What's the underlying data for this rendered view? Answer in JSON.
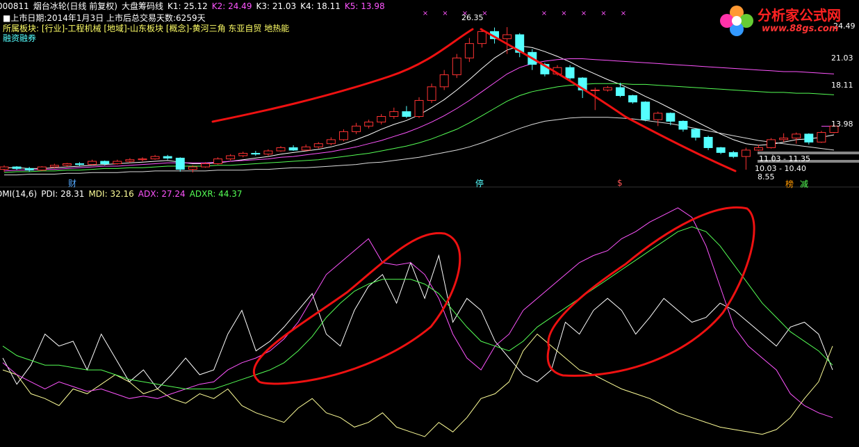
{
  "header": {
    "code": "000811",
    "name": "烟台冰轮(日线 前复权)",
    "indicator": "大盘筹码线",
    "k_values": [
      {
        "label": "K1:",
        "value": "25.12",
        "color": "#ffffff"
      },
      {
        "label": "K2:",
        "value": "24.49",
        "color": "#ff55ff"
      },
      {
        "label": "K3:",
        "value": "21.03",
        "color": "#ffffff"
      },
      {
        "label": "K4:",
        "value": "18.11",
        "color": "#ffffff"
      },
      {
        "label": "K5:",
        "value": "13.98",
        "color": "#ff55ff"
      }
    ]
  },
  "info": {
    "listing": "■上市日期:2014年1月3日 上市后总交易天数:6259天",
    "sectors": "所属板块: [行业]-工程机械 [地域]-山东板块 [概念]-黄河三角 东亚自贸 地热能",
    "margin": "融资融券"
  },
  "markers": {
    "cai": "财",
    "ting": "停",
    "dollar": "$",
    "bang": "榜",
    "jian": "减"
  },
  "price_labels": {
    "high": "26.35",
    "r1": "24.49",
    "r2": "21.03",
    "r3": "18.11",
    "r4": "13.98",
    "range1": "11.03 - 11.35",
    "range2": "10.03 - 10.40",
    "low": "8.55"
  },
  "dmi": {
    "title": "DMI(14,6)",
    "pdi": "PDI: 28.31",
    "mdi": "MDI: 32.16",
    "adx": "ADX: 27.24",
    "adxr": "ADXR: 44.37"
  },
  "logo": {
    "title": "分析家公式网",
    "url": "www.88gs.com"
  },
  "colors": {
    "up": "#ff3333",
    "down": "#55ffff",
    "pdi": "#ffffff",
    "mdi": "#ffff99",
    "adx": "#ff55ff",
    "adxr": "#55ff55",
    "annotation": "#ee1111"
  },
  "chart_data": [
    {
      "type": "candlestick",
      "title": "大盘筹码线",
      "ylim": [
        7,
        28
      ],
      "candles": [
        [
          8.6,
          8.9,
          8.3,
          9.1
        ],
        [
          8.9,
          8.7,
          8.5,
          9.0
        ],
        [
          8.7,
          8.5,
          8.3,
          8.9
        ],
        [
          8.5,
          8.9,
          8.4,
          9.0
        ],
        [
          8.9,
          9.1,
          8.7,
          9.3
        ],
        [
          9.1,
          9.3,
          8.9,
          9.4
        ],
        [
          9.3,
          9.2,
          9.0,
          9.5
        ],
        [
          9.2,
          9.6,
          9.1,
          9.8
        ],
        [
          9.6,
          9.3,
          9.1,
          9.7
        ],
        [
          9.3,
          9.6,
          9.2,
          9.8
        ],
        [
          9.6,
          9.8,
          9.4,
          10.0
        ],
        [
          9.8,
          9.9,
          9.6,
          10.1
        ],
        [
          9.9,
          10.2,
          9.8,
          10.4
        ],
        [
          10.2,
          10.0,
          9.8,
          10.4
        ],
        [
          10.0,
          8.6,
          8.3,
          10.1
        ],
        [
          8.6,
          8.9,
          8.2,
          9.1
        ],
        [
          8.9,
          9.3,
          8.8,
          9.5
        ],
        [
          9.3,
          9.9,
          9.2,
          10.1
        ],
        [
          9.9,
          10.3,
          9.7,
          10.5
        ],
        [
          10.3,
          10.6,
          10.1,
          10.8
        ],
        [
          10.6,
          10.5,
          10.3,
          10.9
        ],
        [
          10.5,
          10.9,
          10.3,
          11.1
        ],
        [
          10.9,
          11.3,
          10.8,
          11.5
        ],
        [
          11.3,
          11.0,
          10.9,
          11.6
        ],
        [
          11.0,
          11.4,
          10.9,
          11.7
        ],
        [
          11.4,
          11.8,
          11.2,
          12.0
        ],
        [
          11.8,
          12.3,
          11.6,
          12.6
        ],
        [
          12.3,
          13.3,
          12.1,
          13.6
        ],
        [
          13.3,
          14.0,
          13.0,
          14.4
        ],
        [
          14.0,
          14.5,
          13.7,
          14.8
        ],
        [
          14.5,
          15.2,
          14.2,
          15.5
        ],
        [
          15.2,
          15.8,
          14.9,
          16.3
        ],
        [
          15.8,
          15.2,
          15.0,
          16.5
        ],
        [
          15.2,
          17.2,
          15.0,
          17.6
        ],
        [
          17.2,
          18.9,
          16.9,
          19.3
        ],
        [
          18.9,
          20.4,
          18.5,
          21.0
        ],
        [
          20.4,
          22.5,
          20.0,
          23.0
        ],
        [
          22.5,
          24.3,
          22.0,
          25.0
        ],
        [
          24.3,
          25.8,
          23.8,
          26.2
        ],
        [
          25.8,
          24.9,
          24.3,
          26.3
        ],
        [
          24.9,
          25.4,
          23.0,
          26.35
        ],
        [
          25.4,
          23.2,
          22.6,
          25.6
        ],
        [
          23.2,
          21.7,
          21.0,
          23.6
        ],
        [
          21.7,
          20.5,
          20.2,
          21.9
        ],
        [
          20.5,
          21.3,
          20.3,
          21.6
        ],
        [
          21.3,
          20.0,
          19.7,
          21.6
        ],
        [
          20.0,
          18.5,
          17.5,
          20.1
        ],
        [
          18.5,
          18.5,
          16.0,
          18.8
        ],
        [
          18.5,
          18.8,
          18.3,
          19.0
        ],
        [
          18.8,
          17.8,
          17.6,
          19.4
        ],
        [
          17.8,
          17.0,
          16.8,
          17.9
        ],
        [
          17.0,
          14.8,
          14.6,
          17.1
        ],
        [
          14.8,
          15.6,
          14.0,
          15.8
        ],
        [
          15.6,
          14.6,
          14.1,
          15.7
        ],
        [
          14.6,
          13.6,
          13.3,
          14.7
        ],
        [
          13.6,
          12.6,
          12.2,
          13.7
        ],
        [
          12.6,
          11.3,
          11.0,
          12.8
        ],
        [
          11.3,
          10.7,
          10.5,
          11.4
        ],
        [
          10.7,
          10.2,
          10.0,
          10.9
        ],
        [
          10.2,
          11.0,
          8.55,
          11.3
        ],
        [
          11.0,
          11.3,
          10.9,
          11.7
        ],
        [
          11.3,
          12.3,
          11.2,
          12.5
        ],
        [
          12.3,
          12.5,
          12.0,
          13.1
        ],
        [
          12.5,
          13.0,
          11.8,
          13.2
        ],
        [
          13.0,
          12.0,
          11.7,
          13.1
        ],
        [
          12.0,
          13.2,
          11.9,
          13.4
        ],
        [
          13.2,
          14.0,
          13.1,
          14.2
        ]
      ],
      "ma_series": [
        {
          "name": "K1",
          "values": [
            8.8,
            8.8,
            8.7,
            8.7,
            8.8,
            8.9,
            9.0,
            9.1,
            9.2,
            9.3,
            9.4,
            9.5,
            9.6,
            9.7,
            9.5,
            9.3,
            9.3,
            9.4,
            9.6,
            9.8,
            10.0,
            10.2,
            10.5,
            10.7,
            10.9,
            11.1,
            11.4,
            11.8,
            12.3,
            12.9,
            13.6,
            14.2,
            14.7,
            15.4,
            16.3,
            17.3,
            18.5,
            19.8,
            21.2,
            22.5,
            23.5,
            24.0,
            23.8,
            23.3,
            22.7,
            22.0,
            21.2,
            20.5,
            19.8,
            19.2,
            18.5,
            17.7,
            17.0,
            16.2,
            15.4,
            14.6,
            13.8,
            13.0,
            12.3,
            11.8,
            11.6,
            11.7,
            12.0,
            12.3,
            12.4,
            12.6,
            12.9
          ]
        },
        {
          "name": "K2",
          "values": [
            8.4,
            8.5,
            8.5,
            8.6,
            8.6,
            8.7,
            8.8,
            8.9,
            9.0,
            9.0,
            9.1,
            9.2,
            9.3,
            9.4,
            9.4,
            9.4,
            9.4,
            9.5,
            9.6,
            9.7,
            9.8,
            9.9,
            10.1,
            10.2,
            10.4,
            10.6,
            10.8,
            11.1,
            11.4,
            11.8,
            12.2,
            12.7,
            13.2,
            13.8,
            14.5,
            15.3,
            16.2,
            17.2,
            18.3,
            19.4,
            20.5,
            21.3,
            21.8,
            22.1,
            22.3,
            22.4,
            22.4,
            22.3,
            22.2,
            22.1,
            22.0,
            21.9,
            21.8,
            21.7,
            21.6,
            21.5,
            21.4,
            21.3,
            21.2,
            21.1,
            21.0,
            20.9,
            20.8,
            20.8,
            20.7,
            20.6,
            20.5
          ]
        },
        {
          "name": "K3",
          "values": [
            8.2,
            8.3,
            8.3,
            8.4,
            8.4,
            8.5,
            8.5,
            8.6,
            8.7,
            8.7,
            8.8,
            8.8,
            8.9,
            9.0,
            9.0,
            9.0,
            9.0,
            9.1,
            9.1,
            9.2,
            9.3,
            9.4,
            9.5,
            9.6,
            9.7,
            9.8,
            10.0,
            10.2,
            10.4,
            10.6,
            10.9,
            11.2,
            11.5,
            11.9,
            12.4,
            13.0,
            13.6,
            14.4,
            15.3,
            16.2,
            17.1,
            17.8,
            18.3,
            18.6,
            18.9,
            19.1,
            19.2,
            19.3,
            19.3,
            19.3,
            19.2,
            19.2,
            19.1,
            19.0,
            18.9,
            18.8,
            18.7,
            18.6,
            18.5,
            18.4,
            18.3,
            18.2,
            18.2,
            18.1,
            18.1,
            18.0,
            17.9
          ]
        },
        {
          "name": "K4",
          "values": [
            7.9,
            7.9,
            8.0,
            8.0,
            8.0,
            8.1,
            8.1,
            8.2,
            8.2,
            8.2,
            8.3,
            8.3,
            8.4,
            8.4,
            8.4,
            8.4,
            8.4,
            8.5,
            8.5,
            8.5,
            8.6,
            8.6,
            8.7,
            8.8,
            8.8,
            8.9,
            9.0,
            9.1,
            9.2,
            9.4,
            9.5,
            9.7,
            9.9,
            10.1,
            10.4,
            10.7,
            11.0,
            11.4,
            11.9,
            12.5,
            13.1,
            13.7,
            14.2,
            14.6,
            14.8,
            15.0,
            15.1,
            15.1,
            15.1,
            15.0,
            14.9,
            14.7,
            14.5,
            14.3,
            14.0,
            13.7,
            13.4,
            13.1,
            12.8,
            12.5,
            12.2,
            12.0,
            11.8,
            11.6,
            11.4,
            11.2,
            11.0
          ]
        },
        {
          "name": "K5",
          "values": [
            null,
            null,
            null,
            null,
            null,
            null,
            null,
            null,
            null,
            null,
            null,
            null,
            null,
            null,
            null,
            null,
            null,
            null,
            null,
            null,
            null,
            null,
            null,
            null,
            null,
            null,
            null,
            null,
            null,
            null,
            null,
            null,
            null,
            null,
            null,
            null,
            null,
            null,
            null,
            null,
            null,
            null,
            null,
            null,
            null,
            null,
            null,
            null,
            null,
            null,
            null,
            null,
            null,
            null,
            null,
            null,
            null,
            null,
            null,
            null,
            null,
            null,
            null,
            null,
            null,
            13.98,
            13.98
          ]
        }
      ]
    },
    {
      "type": "line",
      "title": "DMI(14,6)",
      "ylim": [
        0,
        100
      ],
      "x": [
        0,
        1,
        2,
        3,
        4,
        5,
        6,
        7,
        8,
        9,
        10,
        11,
        12,
        13,
        14,
        15,
        16,
        17,
        18,
        19,
        20,
        21,
        22,
        23,
        24,
        25,
        26,
        27,
        28,
        29,
        30,
        31,
        32,
        33,
        34,
        35,
        36,
        37,
        38,
        39,
        40,
        41,
        42,
        43,
        44,
        45,
        46,
        47,
        48,
        49,
        50,
        51,
        52,
        53,
        54,
        55,
        56,
        57,
        58,
        59
      ],
      "series": [
        {
          "name": "PDI",
          "values": [
            35,
            24,
            32,
            45,
            40,
            42,
            30,
            45,
            35,
            25,
            30,
            22,
            28,
            35,
            28,
            30,
            45,
            55,
            38,
            42,
            48,
            55,
            62,
            45,
            40,
            55,
            65,
            70,
            58,
            75,
            60,
            78,
            50,
            60,
            55,
            42,
            35,
            28,
            25,
            30,
            50,
            45,
            55,
            60,
            55,
            45,
            52,
            60,
            55,
            50,
            52,
            58,
            55,
            50,
            45,
            40,
            48,
            50,
            45,
            30
          ]
        },
        {
          "name": "MDI",
          "values": [
            30,
            28,
            20,
            18,
            15,
            22,
            20,
            24,
            28,
            25,
            20,
            22,
            18,
            16,
            20,
            18,
            22,
            15,
            12,
            10,
            8,
            14,
            18,
            12,
            10,
            6,
            8,
            12,
            6,
            4,
            2,
            8,
            4,
            10,
            18,
            20,
            25,
            38,
            45,
            40,
            35,
            30,
            28,
            25,
            22,
            20,
            18,
            15,
            12,
            10,
            8,
            6,
            5,
            4,
            3,
            5,
            10,
            18,
            25,
            40
          ]
        },
        {
          "name": "ADX",
          "values": [
            33,
            28,
            25,
            22,
            25,
            23,
            21,
            22,
            20,
            18,
            19,
            18,
            20,
            22,
            24,
            25,
            30,
            33,
            35,
            38,
            43,
            50,
            60,
            70,
            75,
            80,
            85,
            75,
            74,
            75,
            70,
            60,
            45,
            35,
            30,
            40,
            45,
            55,
            60,
            65,
            70,
            75,
            78,
            80,
            85,
            88,
            92,
            95,
            98,
            94,
            82,
            65,
            48,
            40,
            35,
            30,
            20,
            15,
            12,
            10
          ]
        },
        {
          "name": "ADXR",
          "values": [
            40,
            36,
            34,
            32,
            32,
            31,
            30,
            30,
            28,
            26,
            25,
            24,
            23,
            22,
            22,
            22,
            24,
            26,
            28,
            30,
            33,
            38,
            44,
            52,
            58,
            63,
            66,
            68,
            68,
            68,
            66,
            62,
            55,
            48,
            42,
            40,
            38,
            42,
            48,
            52,
            56,
            60,
            64,
            68,
            72,
            76,
            80,
            84,
            88,
            90,
            88,
            82,
            74,
            66,
            58,
            52,
            46,
            42,
            38,
            32
          ]
        }
      ]
    }
  ]
}
